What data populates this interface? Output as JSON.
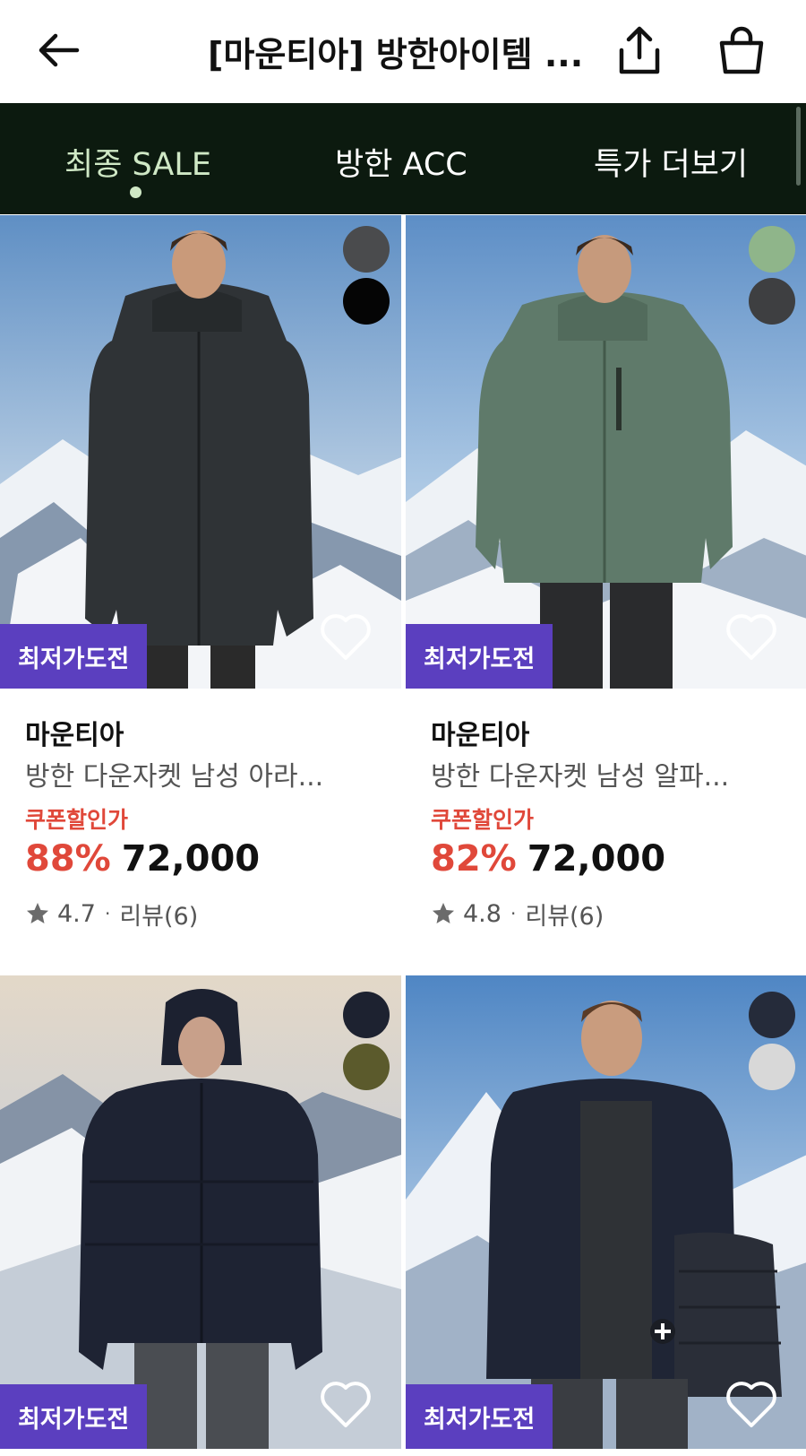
{
  "header": {
    "title": "[마운티아] 방한아이템 ...",
    "back_icon": "arrow-left-icon",
    "share_icon": "share-icon",
    "bag_icon": "shopping-bag-icon"
  },
  "tabs": [
    {
      "label": "최종 SALE",
      "active": true
    },
    {
      "label": "방한 ACC",
      "active": false
    },
    {
      "label": "특가 더보기",
      "active": false
    }
  ],
  "colors": {
    "tab_bg": "#0c1a0f",
    "tab_active": "#cfe8c5",
    "badge_bg": "#5b3fbf",
    "discount": "#e0483a"
  },
  "products": [
    {
      "brand": "마운티아",
      "name": "방한 다운자켓 남성 아라...",
      "badge": "최저가도전",
      "coupon": "쿠폰할인가",
      "discount": "88%",
      "price": "72,000",
      "rating": "4.7",
      "reviews": "리뷰(6)",
      "swatches": [
        "#4a4b4d",
        "#050505"
      ]
    },
    {
      "brand": "마운티아",
      "name": "방한 다운자켓 남성 알파...",
      "badge": "최저가도전",
      "coupon": "쿠폰할인가",
      "discount": "82%",
      "price": "72,000",
      "rating": "4.8",
      "reviews": "리뷰(6)",
      "swatches": [
        "#8fb58a",
        "#3e3f41"
      ]
    },
    {
      "badge": "최저가도전",
      "swatches": [
        "#1d2230",
        "#5b5a2c"
      ]
    },
    {
      "badge": "최저가도전",
      "swatches": [
        "#252b3a",
        "#d8d8d8"
      ]
    }
  ]
}
